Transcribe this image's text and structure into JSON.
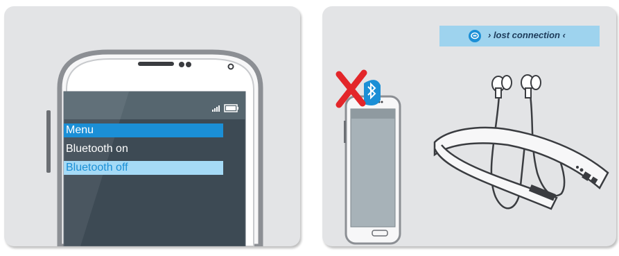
{
  "phone_menu": {
    "title": "Menu",
    "items": [
      "Bluetooth on",
      "Bluetooth off"
    ],
    "selected": "Bluetooth off"
  },
  "status_banner": {
    "text": "› lost connection ‹",
    "icon": "chat-bubble-icon"
  },
  "colors": {
    "accent": "#1b8fd6",
    "selected_bg": "#a5daf6",
    "banner_bg": "#9ed3ee",
    "error_red": "#e3262a"
  }
}
